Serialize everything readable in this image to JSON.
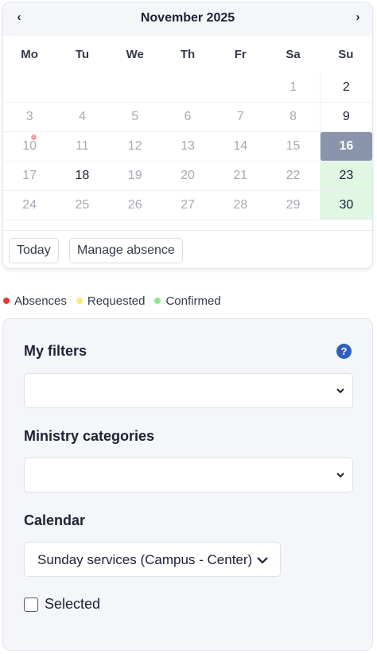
{
  "calendar": {
    "month_title": "November 2025",
    "prev_icon": "chevron-left-icon",
    "next_icon": "chevron-right-icon",
    "weekdays": [
      "Mo",
      "Tu",
      "We",
      "Th",
      "Fr",
      "Sa",
      "Su"
    ],
    "weeks": [
      [
        "",
        "",
        "",
        "",
        "",
        "1",
        "2"
      ],
      [
        "3",
        "4",
        "5",
        "6",
        "7",
        "8",
        "9"
      ],
      [
        "10",
        "11",
        "12",
        "13",
        "14",
        "15",
        "16"
      ],
      [
        "17",
        "18",
        "19",
        "20",
        "21",
        "22",
        "23"
      ],
      [
        "24",
        "25",
        "26",
        "27",
        "28",
        "29",
        "30"
      ]
    ],
    "selected_day": "16",
    "confirmed_days": [
      "23",
      "30"
    ],
    "absence_days": [
      "10"
    ],
    "emphasized_days": [
      "2",
      "9",
      "18"
    ],
    "today_button": "Today",
    "manage_absence_button": "Manage absence"
  },
  "legend": [
    {
      "label": "Absences",
      "color": "#e53935"
    },
    {
      "label": "Requested",
      "color": "#f5ec7a"
    },
    {
      "label": "Confirmed",
      "color": "#8ee88f"
    }
  ],
  "filters": {
    "my_filters_label": "My filters",
    "help_icon": "question-icon",
    "my_filters_value": "",
    "ministry_categories_label": "Ministry categories",
    "ministry_categories_value": "",
    "calendar_label": "Calendar",
    "calendar_value": "Sunday services (Campus - Center)",
    "selected_label": "Selected",
    "selected_checked": false
  },
  "colors": {
    "selected_day_bg": "#8a94ab",
    "confirmed_day_bg": "#e0f7e4",
    "help_bg": "#2d5fbd"
  }
}
